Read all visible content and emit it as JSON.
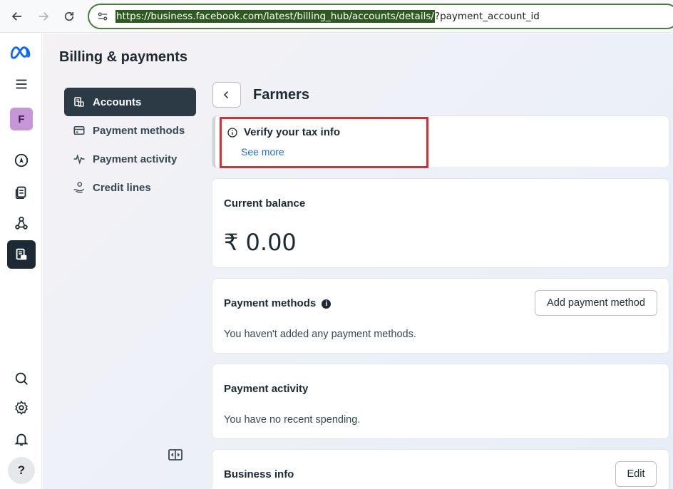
{
  "browser": {
    "url_selected": "https://business.facebook.com/latest/billing_hub/accounts/details/",
    "url_rest": "?payment_account_id"
  },
  "rail": {
    "avatar_letter": "F",
    "help_label": "?"
  },
  "page": {
    "title": "Billing & payments"
  },
  "side_nav": {
    "items": [
      {
        "label": "Accounts",
        "icon": "accounts-icon",
        "active": true
      },
      {
        "label": "Payment methods",
        "icon": "card-icon"
      },
      {
        "label": "Payment activity",
        "icon": "activity-icon"
      },
      {
        "label": "Credit lines",
        "icon": "credit-hand-icon"
      }
    ]
  },
  "account": {
    "name": "Farmers"
  },
  "tax_notice": {
    "title": "Verify your tax info",
    "link": "See more"
  },
  "balance": {
    "heading": "Current balance",
    "value": "₹ 0.00"
  },
  "payment_methods": {
    "heading": "Payment methods",
    "info": "i",
    "button": "Add payment method",
    "empty_text": "You haven't added any payment methods."
  },
  "payment_activity": {
    "heading": "Payment activity",
    "empty_text": "You have no recent spending."
  },
  "business_info": {
    "heading": "Business info",
    "button": "Edit"
  },
  "colors": {
    "accent": "#1a6ed8",
    "active_nav": "#2b3a44",
    "highlight": "#cc3333"
  }
}
